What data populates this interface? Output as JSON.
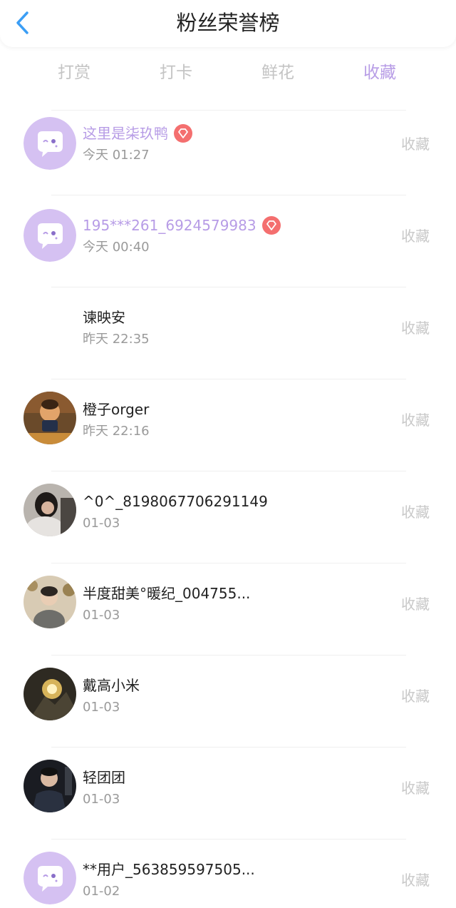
{
  "header": {
    "title": "粉丝荣誉榜"
  },
  "tabs": [
    {
      "label": "打赏"
    },
    {
      "label": "打卡"
    },
    {
      "label": "鲜花"
    },
    {
      "label": "收藏"
    }
  ],
  "active_tab_index": 3,
  "colors": {
    "accent": "#b79ce6",
    "back_arrow": "#3b9ef5",
    "badge": "#f46f6f"
  },
  "rows": [
    {
      "name": "这里是柒玖鸭",
      "time": "今天 01:27",
      "action": "收藏",
      "avatar": "default-chat-avatar",
      "vip": true
    },
    {
      "name": "195***261_6924579983",
      "time": "今天 00:40",
      "action": "收藏",
      "avatar": "default-chat-avatar",
      "vip": true
    },
    {
      "name": "谏映安",
      "time": "昨天 22:35",
      "action": "收藏",
      "avatar": "none",
      "vip": false
    },
    {
      "name": "橙子orger",
      "time": "昨天 22:16",
      "action": "收藏",
      "avatar": "photo",
      "vip": false
    },
    {
      "name": "^0^_8198067706291149",
      "time": "01-03",
      "action": "收藏",
      "avatar": "photo",
      "vip": false
    },
    {
      "name": "半度甜美°暖纪_004755...",
      "time": "01-03",
      "action": "收藏",
      "avatar": "photo",
      "vip": false
    },
    {
      "name": "戴高小米",
      "time": "01-03",
      "action": "收藏",
      "avatar": "photo",
      "vip": false
    },
    {
      "name": "轻团团",
      "time": "01-03",
      "action": "收藏",
      "avatar": "photo",
      "vip": false
    },
    {
      "name": "**用户_563859597505...",
      "time": "01-02",
      "action": "收藏",
      "avatar": "default-chat-avatar",
      "vip": false
    }
  ]
}
